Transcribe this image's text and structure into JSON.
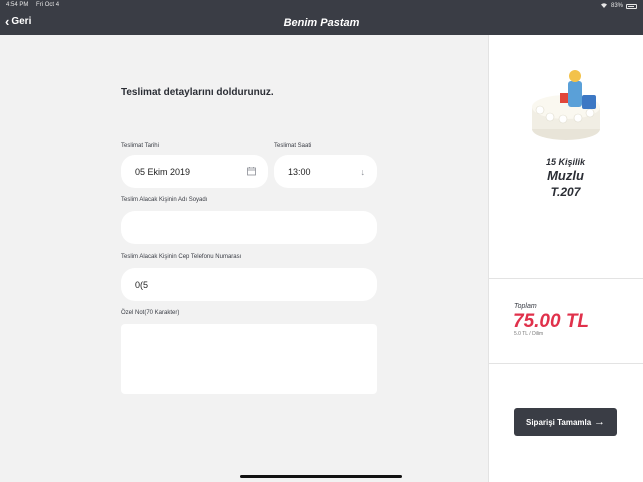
{
  "status": {
    "time": "4:54 PM",
    "date": "Fri Oct 4",
    "battery": "83%"
  },
  "header": {
    "back_label": "Geri",
    "title": "Benim Pastam"
  },
  "form": {
    "heading": "Teslimat detaylarını doldurunuz.",
    "date_label": "Teslimat Tarihi",
    "date_value": "05 Ekim 2019",
    "time_label": "Teslimat Saati",
    "time_value": "13:00",
    "name_label": "Teslim Alacak Kişinin Adı Soyadı",
    "name_value": "",
    "phone_label": "Teslim Alacak Kişinin Cep Telefonu Numarası",
    "phone_value": "0(5",
    "note_label": "Özel Not(70 Karakter)",
    "note_value": ""
  },
  "product": {
    "servings": "15 Kişilik",
    "name": "Muzlu",
    "code": "T.207"
  },
  "summary": {
    "total_label": "Toplam",
    "total": "75.00 TL",
    "unit_price": "5.0 TL / Dilim"
  },
  "cta": {
    "label": "Siparişi Tamamla"
  },
  "colors": {
    "header_bg": "#3a3d45",
    "accent": "#e0314b",
    "button_bg": "#3a3d45"
  },
  "icons": [
    "chevron-left-icon",
    "wifi-icon",
    "battery-icon",
    "calendar-icon",
    "arrow-down-icon",
    "arrow-right-icon"
  ]
}
